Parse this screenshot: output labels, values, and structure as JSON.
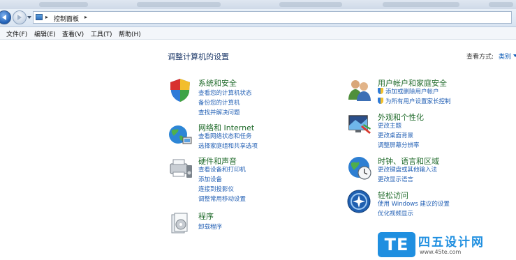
{
  "window": {
    "breadcrumb": "控制面板"
  },
  "menu": [
    "文件(F)",
    "编辑(E)",
    "查看(V)",
    "工具(T)",
    "帮助(H)"
  ],
  "main": {
    "title": "调整计算机的设置",
    "view_by_label": "查看方式:",
    "view_by_value": "类别"
  },
  "categories": {
    "system": {
      "heading": "系统和安全",
      "links": [
        "查看您的计算机状态",
        "备份您的计算机",
        "查找并解决问题"
      ],
      "icon": "system-security-icon"
    },
    "network": {
      "heading": "网络和 Internet",
      "links": [
        "查看网络状态和任务",
        "选择家庭组和共享选项"
      ],
      "icon": "network-internet-icon"
    },
    "hardware": {
      "heading": "硬件和声音",
      "links": [
        "查看设备和打印机",
        "添加设备",
        "连接到投影仪",
        "调整常用移动设置"
      ],
      "icon": "hardware-sound-icon"
    },
    "programs": {
      "heading": "程序",
      "links": [
        "卸载程序"
      ],
      "icon": "programs-icon"
    },
    "users": {
      "heading": "用户帐户和家庭安全",
      "links": [
        "添加或删除用户帐户",
        "为所有用户设置家长控制"
      ],
      "icon": "user-accounts-icon"
    },
    "appearance": {
      "heading": "外观和个性化",
      "links": [
        "更改主题",
        "更改桌面背景",
        "调整屏幕分辨率"
      ],
      "icon": "appearance-icon"
    },
    "clock": {
      "heading": "时钟、语言和区域",
      "links": [
        "更改键盘或其他输入法",
        "更改显示语言"
      ],
      "icon": "clock-region-icon"
    },
    "ease": {
      "heading": "轻松访问",
      "links": [
        "使用 Windows 建议的设置",
        "优化视频显示"
      ],
      "icon": "ease-of-access-icon"
    }
  },
  "watermark": {
    "logo": "TE",
    "title": "四五设计网",
    "url": "www.45te.com"
  },
  "colors": {
    "heading_green": "#1f6a2a",
    "link_blue": "#2461b5",
    "watermark_blue": "#1f8fe0"
  }
}
